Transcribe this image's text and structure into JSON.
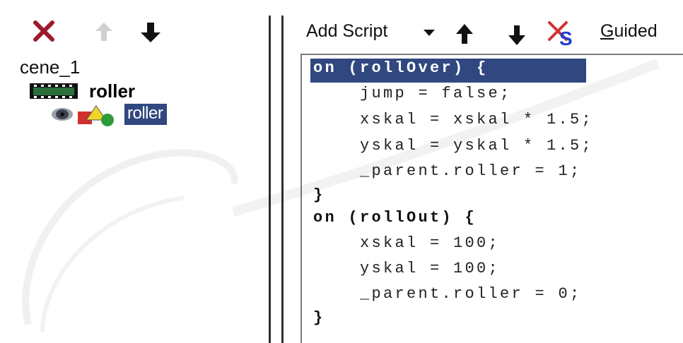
{
  "left_panel": {
    "toolbar": {
      "icons": [
        "delete-icon",
        "move-up-icon",
        "move-down-icon"
      ]
    },
    "tree": {
      "scene_label": "cene_1",
      "clip_label": "roller",
      "instance_label": "roller"
    }
  },
  "right_panel": {
    "toolbar": {
      "add_script_label": "Add Script",
      "guided_label_first": "G",
      "guided_label_rest": "uided"
    },
    "code_lines": [
      "on (rollOver) {",
      "    jump = false;",
      "    xskal = xskal * 1.5;",
      "    yskal = yskal * 1.5;",
      "    _parent.roller = 1;",
      "}",
      "on (rollOut) {",
      "    xskal = 100;",
      "    yskal = 100;",
      "    _parent.roller = 0;",
      "}"
    ]
  },
  "colors": {
    "selection": "#30477f",
    "delete_icon": "#9b1c2c",
    "script_icon": "#1f3fd6"
  }
}
